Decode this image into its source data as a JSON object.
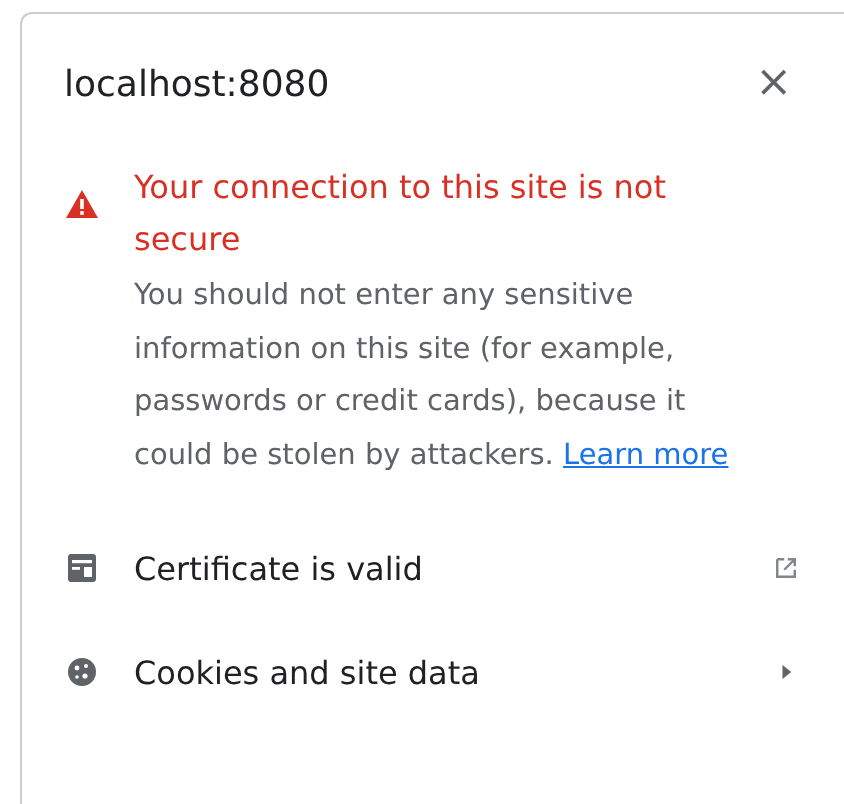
{
  "popup": {
    "title": "localhost:8080",
    "close": "×"
  },
  "warning": {
    "heading": "Your connection to this site is not secure",
    "message": "You should not enter any sensitive information on this site (for example, passwords or credit cards), because it could be stolen by attackers.",
    "link": "Learn more"
  },
  "items": [
    {
      "kind": "certificate",
      "label": "Certificate is valid"
    },
    {
      "kind": "cookies",
      "label": "Cookies and site data"
    }
  ]
}
